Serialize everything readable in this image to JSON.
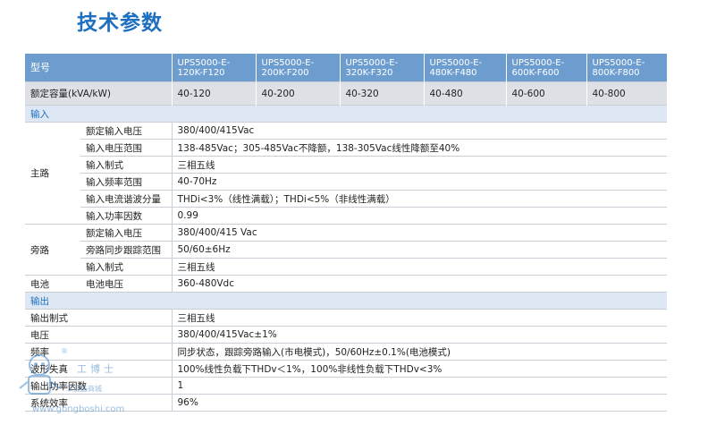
{
  "title": "技术参数",
  "header": {
    "label": "型号",
    "models": [
      "UPS5000-E-120K-F120",
      "UPS5000-E-200K-F200",
      "UPS5000-E-320K-F320",
      "UPS5000-E-480K-F480",
      "UPS5000-E-600K-F600",
      "UPS5000-E-800K-F800"
    ]
  },
  "capacity": {
    "label": "额定容量(kVA/kW)",
    "values": [
      "40-120",
      "40-200",
      "40-320",
      "40-480",
      "40-600",
      "40-800"
    ]
  },
  "input_section": {
    "title": "输入",
    "main": {
      "group": "主路",
      "rows": [
        {
          "label": "额定输入电压",
          "value": "380/400/415Vac"
        },
        {
          "label": "输入电压范围",
          "value": " 138-485Vac；305-485Vac不降额，138-305Vac线性降额至40%"
        },
        {
          "label": "输入制式",
          "value": "三相五线"
        },
        {
          "label": "输入频率范围",
          "value": "40-70Hz"
        },
        {
          "label": "输入电流谐波分量",
          "value": " THDi<3%（线性满载）；THDi<5%（非线性满载）"
        },
        {
          "label": "输入功率因数",
          "value": "0.99"
        }
      ]
    },
    "bypass": {
      "group": "旁路",
      "rows": [
        {
          "label": "额定输入电压",
          "value": "380/400/415 Vac"
        },
        {
          "label": "旁路同步跟踪范围",
          "value": "50/60±6Hz"
        },
        {
          "label": "输入制式",
          "value": "三相五线"
        }
      ]
    },
    "battery": {
      "group": "电池",
      "label": "电池电压",
      "value": "360-480Vdc"
    }
  },
  "output_section": {
    "title": "输出",
    "rows": [
      {
        "label": "输出制式",
        "value": "三相五线"
      },
      {
        "label": "电压",
        "value": "380/400/415Vac±1%"
      },
      {
        "label": "频率",
        "value": "同步状态，跟踪旁路输入(市电模式)，50/60Hz±0.1%(电池模式)"
      },
      {
        "label": "波形失真",
        "value": "100%线性负载下THDv＜1%，100%非线性负载下THDv<3%"
      },
      {
        "label": "输出功率因数",
        "value": "1"
      },
      {
        "label": "系统效率",
        "value": "96%"
      }
    ]
  },
  "watermark": {
    "brand": "工博士",
    "registered": "®",
    "subtitle": "工业品商城",
    "url": "www.gongboshi.com"
  },
  "colors": {
    "title": "#1d6fc0",
    "header_bg": "#6d9dcf",
    "capacity_bg": "#dde1e6",
    "section_bg": "#dde8f4"
  }
}
